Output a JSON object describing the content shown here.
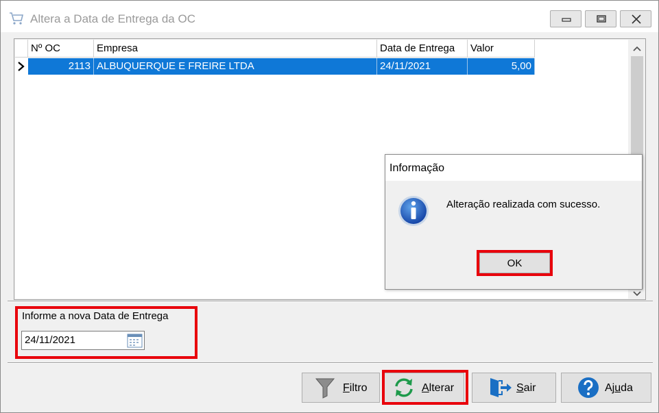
{
  "window": {
    "title": "Altera a Data de Entrega da OC"
  },
  "grid": {
    "columns": [
      "Nº OC",
      "Empresa",
      "Data de Entrega",
      "Valor"
    ],
    "rows": [
      {
        "indicator": "▶",
        "oc": "2113",
        "empresa": "ALBUQUERQUE E FREIRE LTDA",
        "data": "24/11/2021",
        "valor": "5,00"
      }
    ]
  },
  "form": {
    "label": "Informe a nova Data de Entrega",
    "date_value": "24/11/2021"
  },
  "buttons": {
    "filtro": {
      "pre": "",
      "ul": "F",
      "post": "iltro"
    },
    "alterar": {
      "pre": "",
      "ul": "A",
      "post": "lterar"
    },
    "sair": {
      "pre": "",
      "ul": "S",
      "post": "air"
    },
    "ajuda": {
      "pre": "Aj",
      "ul": "u",
      "post": "da"
    }
  },
  "dialog": {
    "title": "Informação",
    "message": "Alteração realizada com sucesso.",
    "ok_label": "OK"
  },
  "colors": {
    "selection": "#0f78d7",
    "highlight": "#e8000b",
    "accent_green": "#1e9a4b",
    "accent_blue": "#1a6fc4"
  }
}
